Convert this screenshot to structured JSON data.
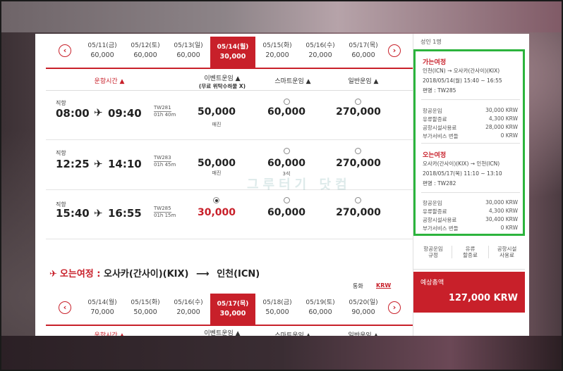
{
  "outbound": {
    "dates": [
      {
        "date": "05/11(금)",
        "price": "60,000"
      },
      {
        "date": "05/12(토)",
        "price": "60,000"
      },
      {
        "date": "05/13(일)",
        "price": "60,000"
      },
      {
        "date": "05/14(월)",
        "price": "30,000",
        "selected": true
      },
      {
        "date": "05/15(화)",
        "price": "20,000"
      },
      {
        "date": "05/16(수)",
        "price": "20,000"
      },
      {
        "date": "05/17(목)",
        "price": "60,000"
      }
    ],
    "headers": {
      "time": "운항시간 ▲",
      "event": "이벤트운임 ▲",
      "event_sub": "(무료 위탁수하물 X)",
      "smart": "스마트운임 ▲",
      "normal": "일반운임 ▲"
    },
    "flights": [
      {
        "type": "직항",
        "dep": "08:00",
        "arr": "09:40",
        "fno": "TW281",
        "dur": "01h 40m",
        "event": "50,000",
        "event_note": "매진",
        "smart": "60,000",
        "smart_note": "",
        "normal": "270,000"
      },
      {
        "type": "직항",
        "dep": "12:25",
        "arr": "14:10",
        "fno": "TW283",
        "dur": "01h 45m",
        "event": "50,000",
        "event_note": "매진",
        "smart": "60,000",
        "smart_note": "3석",
        "normal": "270,000"
      },
      {
        "type": "직항",
        "dep": "15:40",
        "arr": "16:55",
        "fno": "TW285",
        "dur": "01h 15m",
        "event": "30,000",
        "event_note": "",
        "smart": "60,000",
        "smart_note": "",
        "normal": "270,000"
      }
    ]
  },
  "return": {
    "title_label": "오는여정 :",
    "route_from": "오사카(간사이)(KIX)",
    "route_arrow": "⟶",
    "route_to": "인천(ICN)",
    "currency_label": "통화",
    "currency": "KRW",
    "dates": [
      {
        "date": "05/14(월)",
        "price": "70,000"
      },
      {
        "date": "05/15(화)",
        "price": "50,000"
      },
      {
        "date": "05/16(수)",
        "price": "20,000"
      },
      {
        "date": "05/17(목)",
        "price": "30,000",
        "selected": true
      },
      {
        "date": "05/18(금)",
        "price": "50,000"
      },
      {
        "date": "05/19(토)",
        "price": "60,000"
      },
      {
        "date": "05/20(일)",
        "price": "90,000"
      }
    ],
    "headers": {
      "time": "운항시간 ▲",
      "event": "이벤트운임 ▲",
      "smart": "스마트운임 ▲",
      "normal": "일반운임 ▲"
    }
  },
  "summary": {
    "passengers": "성인 1명",
    "outbound": {
      "title": "가는여정",
      "route": "인천(ICN) → 오사카(간사이)(KIX)",
      "datetime": "2018/05/14(월) 15:40 ~ 16:55",
      "flight": "편명 : TW285",
      "fees": [
        {
          "name": "항공운임",
          "value": "30,000 KRW"
        },
        {
          "name": "유류할증료",
          "value": "4,300 KRW"
        },
        {
          "name": "공항시설사용료",
          "value": "28,000 KRW"
        },
        {
          "name": "부가서비스 번들",
          "value": "0 KRW"
        }
      ]
    },
    "return": {
      "title": "오는여정",
      "route": "오사카(간사이)(KIX) → 인천(ICN)",
      "datetime": "2018/05/17(목) 11:10 ~ 13:10",
      "flight": "편명 : TW282",
      "fees": [
        {
          "name": "항공운임",
          "value": "30,000 KRW"
        },
        {
          "name": "유류할증료",
          "value": "4,300 KRW"
        },
        {
          "name": "공항시설사용료",
          "value": "30,400 KRW"
        },
        {
          "name": "부가서비스 번들",
          "value": "0 KRW"
        }
      ]
    },
    "fee_buttons": [
      {
        "l1": "항공운임",
        "l2": "규정"
      },
      {
        "l1": "유류",
        "l2": "할증료"
      },
      {
        "l1": "공항시설",
        "l2": "사용료"
      }
    ],
    "total_label": "예상총액",
    "total_amount": "127,000 KRW"
  },
  "watermark": "그루터기 닷컴",
  "icons": {
    "prev": "chevron-left-icon",
    "next": "chevron-right-icon",
    "plane": "airplane-icon"
  },
  "colors": {
    "accent": "#c8202a",
    "highlight": "#2cb43d"
  }
}
